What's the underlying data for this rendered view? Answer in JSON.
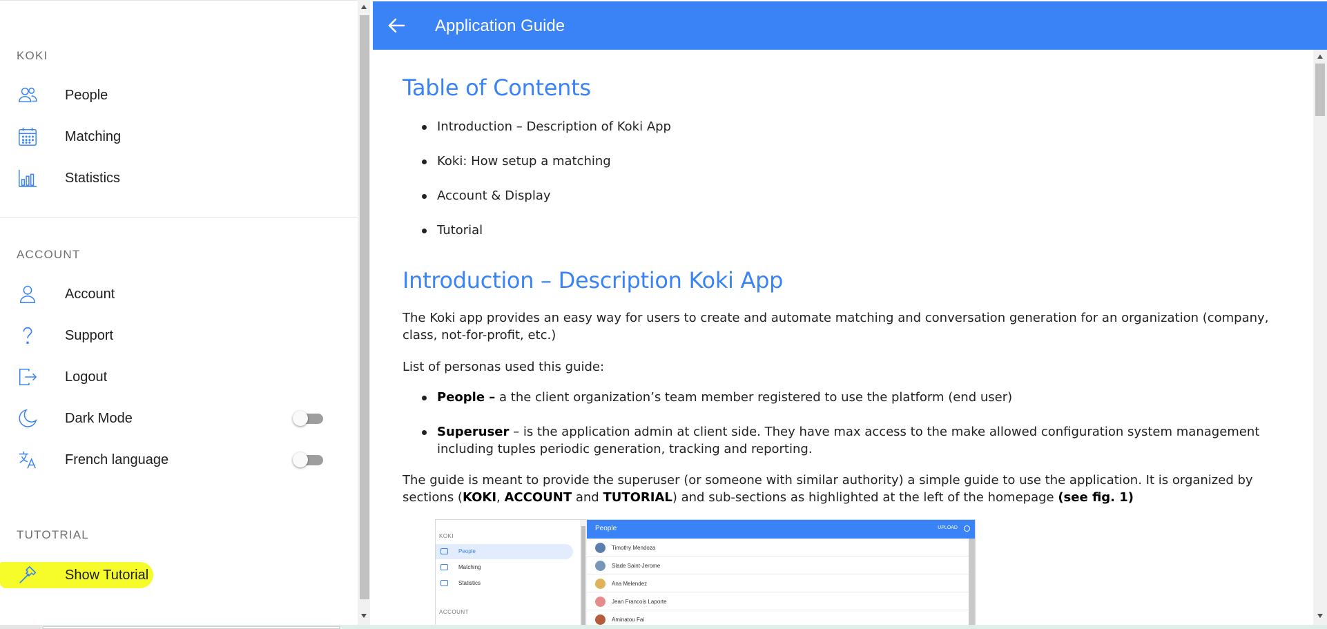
{
  "sidebar": {
    "sections": {
      "koki": "KOKI",
      "account": "ACCOUNT",
      "tutorial": "TUTOTRIAL"
    },
    "items": {
      "people": "People",
      "matching": "Matching",
      "statistics": "Statistics",
      "account": "Account",
      "support": "Support",
      "logout": "Logout",
      "dark_mode": "Dark Mode",
      "french_language": "French language",
      "show_tutorial": "Show Tutorial"
    },
    "toggles": {
      "dark_mode": false,
      "french_language": false
    },
    "accent_color": "#3a83f7",
    "highlight_color": "#f6fc2a"
  },
  "header": {
    "title": "Application Guide",
    "back_icon": "arrow-left-icon",
    "color": "#3a83f7"
  },
  "content": {
    "toc_title": "Table of Contents",
    "toc": [
      "Introduction – Description of Koki App",
      "Koki: How setup a matching",
      "Account & Display",
      "Tutorial"
    ],
    "intro_title": "Introduction – Description Koki App",
    "intro_p1": "The Koki app provides an easy way for users to create and automate matching and conversation generation for an organization (company, class, not-for-profit, etc.)",
    "intro_p2": "List of personas used this guide:",
    "persona1_term": "People –",
    "persona1_text": " a the client organization’s team member registered to use the platform (end user)",
    "persona2_term": "Superuser",
    "persona2_text": " – is the application admin at client side. They have max access to the make allowed configuration system management including tuples periodic generation, tracking and reporting.",
    "guide_p_start": "The guide is meant to provide the superuser (or someone with similar authority) a simple guide to use the application. It is organized by sections (",
    "guide_koki": "KOKI",
    "guide_sep1": ", ",
    "guide_account": "ACCOUNT",
    "guide_and": " and ",
    "guide_tutorial": "TUTORIAL",
    "guide_mid": ") and sub-sections as highlighted at the left of the homepage ",
    "guide_see": "(see fig. 1)"
  },
  "figure": {
    "sidebar_sections": [
      "KOKI",
      "ACCOUNT"
    ],
    "sidebar_items": [
      "People",
      "Matching",
      "Statistics"
    ],
    "header_title": "People",
    "upload_label": "UPLOAD",
    "people": [
      "Timothy Mendoza",
      "Slade Saint-Jerome",
      "Ana Melendez",
      "Jean Francois Laporte",
      "Aminatou Fai"
    ]
  }
}
